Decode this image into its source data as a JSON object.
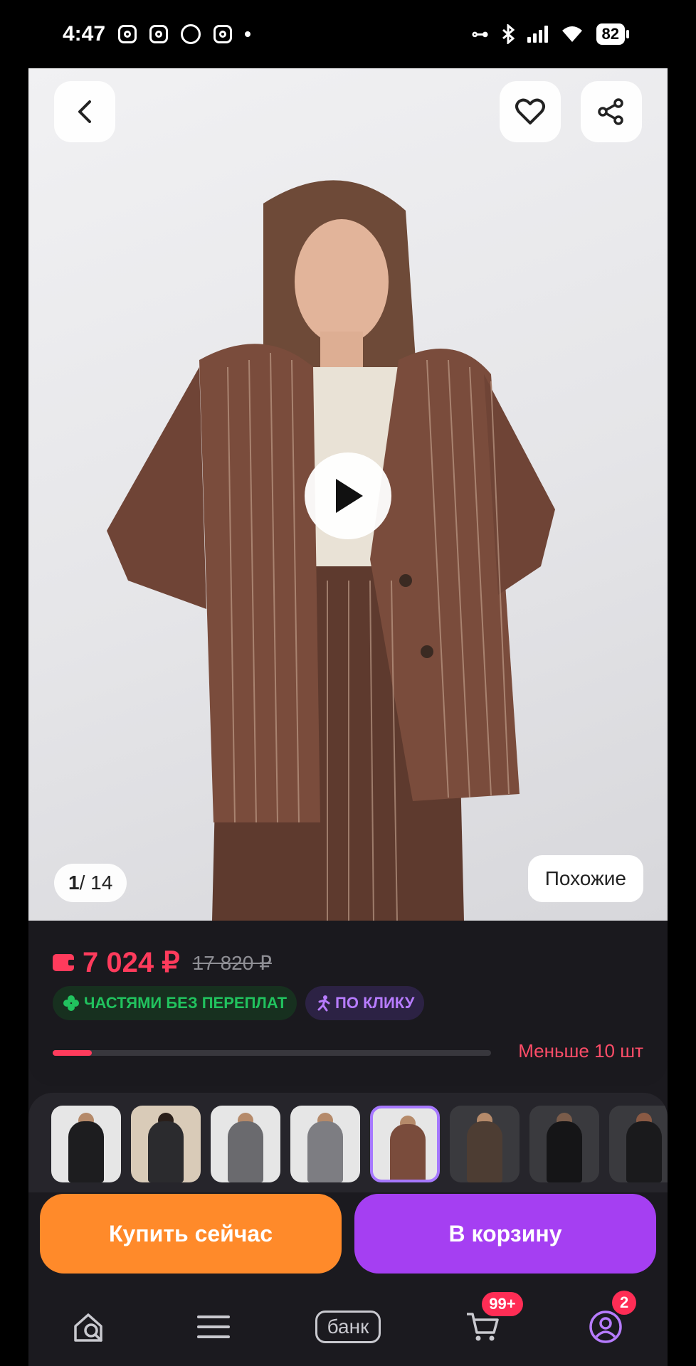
{
  "status_bar": {
    "time": "4:47",
    "battery": "82",
    "key_icon": "⊶"
  },
  "product": {
    "photo_counter_current": "1",
    "photo_counter_total": "/ 14",
    "similar_label": "Похожие",
    "price": "7 024 ₽",
    "old_price": "17 820 ₽",
    "badge_installments": "ЧАСТЯМИ БЕЗ ПЕРЕПЛАТ",
    "badge_one_click": "ПО КЛИКУ",
    "stock_text": "Меньше 10 шт",
    "stock_fraction": 0.09
  },
  "actions": {
    "buy_now": "Купить сейчас",
    "add_to_cart": "В корзину"
  },
  "bottom_nav": {
    "bank_label": "банк",
    "cart_badge": "99+",
    "profile_badge": "2"
  },
  "colors": {
    "price_accent": "#ff3b5c",
    "buy_button": "#ff8a2a",
    "cart_button": "#a53ff2",
    "installments_green": "#21c25e",
    "one_click_purple": "#b77cff"
  }
}
